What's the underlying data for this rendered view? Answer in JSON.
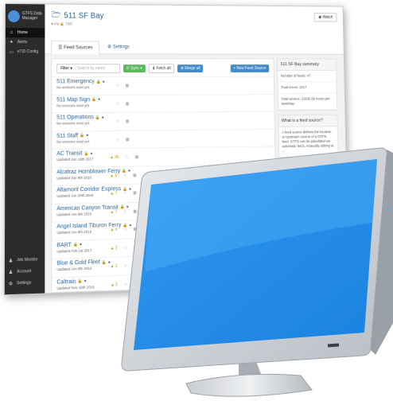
{
  "app": {
    "brand_line1": "GTFS Data",
    "brand_line2": "Manager"
  },
  "sidebar": {
    "items": [
      {
        "icon": "⌂",
        "label": "Home"
      },
      {
        "icon": "●",
        "label": "Alerts"
      },
      {
        "icon": "▭",
        "label": "eTID Config"
      }
    ],
    "bottom": [
      {
        "icon": "♟",
        "label": "Job Monitor"
      },
      {
        "icon": "♟",
        "label": "Account"
      },
      {
        "icon": "⚙",
        "label": "Settings"
      }
    ]
  },
  "project": {
    "title": "511 SF Bay",
    "meta": "♥ n/a  🔒 73/0",
    "watch_label": "◉ Watch"
  },
  "tabs": [
    {
      "icon": "☰",
      "label": "Feed Sources"
    },
    {
      "icon": "⚙",
      "label": "Settings"
    }
  ],
  "toolbar": {
    "filter_label": "Filter ▾",
    "search_placeholder": "Search by name",
    "sync_label": "⟳ Sync ▾",
    "fetch_label": "⬇ Fetch all",
    "merge_label": "⊕ Merge all",
    "new_label": "+ New Feed Source"
  },
  "feeds": [
    {
      "name": "511 Emergency",
      "sub": "No versions exist yet.",
      "warn": "",
      "count": ""
    },
    {
      "name": "511 Map Sign",
      "sub": "No versions exist yet.",
      "warn": "",
      "count": ""
    },
    {
      "name": "511 Operations",
      "sub": "No versions exist yet.",
      "warn": "",
      "count": ""
    },
    {
      "name": "511 Staff",
      "sub": "No versions exist yet.",
      "warn": "",
      "count": ""
    },
    {
      "name": "AC Transit",
      "sub": "Updated Jun 19th 2017",
      "warn": "▲",
      "count": "45"
    },
    {
      "name": "Alcatraz Hornblower Ferry",
      "sub": "Updated Jun 9th 2016",
      "warn": "▲",
      "count": "6"
    },
    {
      "name": "Altamont Corridor Express",
      "sub": "Updated Jun 28th 2016",
      "warn": "▲",
      "count": "7"
    },
    {
      "name": "American Canyon Transit",
      "sub": "Updated Jun 9th 2016",
      "warn": "▲",
      "count": "7"
    },
    {
      "name": "Angel Island Tiburon Ferry",
      "sub": "Updated Jun 9th 2016",
      "warn": "▲",
      "count": "6"
    },
    {
      "name": "BART",
      "sub": "Updated Feb 1st 2017",
      "warn": "▲",
      "count": "2"
    },
    {
      "name": "Blue & Gold Fleet",
      "sub": "Updated Jun 9th 2016",
      "warn": "▲",
      "count": "2"
    },
    {
      "name": "Caltrain",
      "sub": "Updated Nov 15th 2016",
      "warn": "▲",
      "count": "2"
    }
  ],
  "summary": {
    "title": "511 SF Bay summary",
    "rows": [
      "Number of feeds: 47",
      "Total errors: 2017",
      "Total service: 21635.56 hours per weekday"
    ]
  },
  "help": {
    "title": "What is a feed source?",
    "body": "A feed source defines the location or upstream source of a GTFS feed. GTFS can be populated via automatic fetch, manually editing or ..."
  },
  "colors": {
    "sidebar": "#2b2b2b",
    "link": "#2a6496",
    "green": "#5cb85c",
    "blue": "#428bca",
    "screen_blue": "#1f8fe8"
  }
}
